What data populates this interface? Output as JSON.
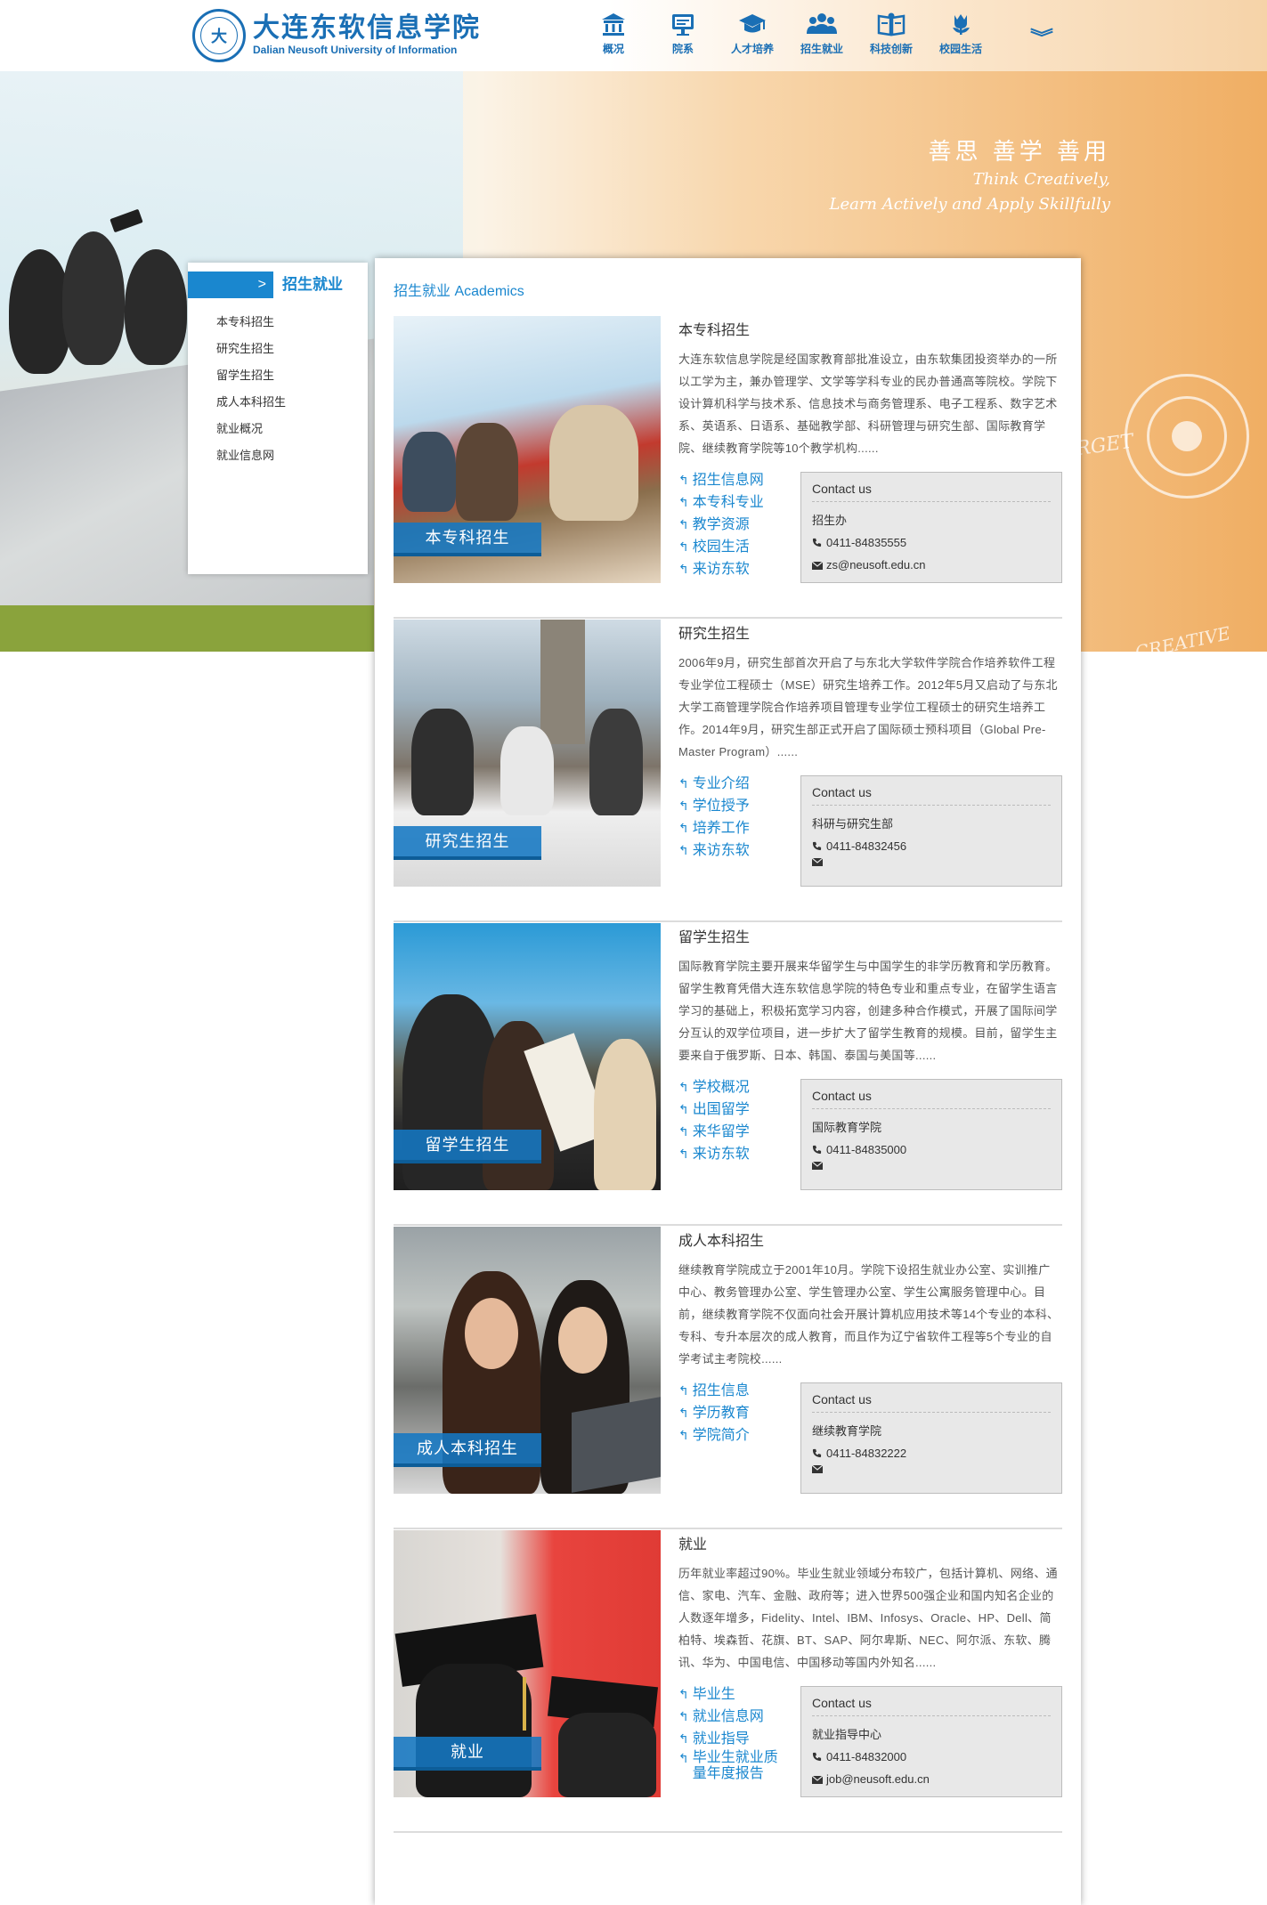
{
  "header": {
    "logo_seal": "大",
    "logo_cn": "大连东软信息学院",
    "logo_en": "Dalian Neusoft University of Information",
    "nav": [
      {
        "label": "概况",
        "icon": "building-icon"
      },
      {
        "label": "院系",
        "icon": "board-icon"
      },
      {
        "label": "人才培养",
        "icon": "graduation-cap-icon"
      },
      {
        "label": "招生就业",
        "icon": "people-icon"
      },
      {
        "label": "科技创新",
        "icon": "book-icon"
      },
      {
        "label": "校园生活",
        "icon": "tulip-icon"
      }
    ],
    "more_icon": "double-chevron-down-icon",
    "more_label": "︾"
  },
  "banner": {
    "slogan_cn": "善思 善学 善用",
    "slogan_en_1": "Think Creatively,",
    "slogan_en_2": "Learn Actively and Apply Skillfully",
    "sketch_word_1": "TARGET",
    "sketch_word_2": "CREATIVE"
  },
  "sidebar": {
    "arrow": ">",
    "title": "招生就业",
    "items": [
      "本专科招生",
      "研究生招生",
      "留学生招生",
      "成人本科招生",
      "就业概况",
      "就业信息网"
    ]
  },
  "main": {
    "title": "招生就业 Academics",
    "contact_title": "Contact us",
    "entries": [
      {
        "photo_label": "本专科招生",
        "title": "本专科招生",
        "desc": "大连东软信息学院是经国家教育部批准设立，由东软集团投资举办的一所以工学为主，兼办管理学、文学等学科专业的民办普通高等院校。学院下设计算机科学与技术系、信息技术与商务管理系、电子工程系、数字艺术系、英语系、日语系、基础教学部、科研管理与研究生部、国际教育学院、继续教育学院等10个教学机构......",
        "links": [
          "招生信息网",
          "本专科专业",
          "教学资源",
          "校园生活",
          "来访东软"
        ],
        "contact": {
          "dept": "招生办",
          "phone": "0411-84835555",
          "email": "zs@neusoft.edu.cn"
        }
      },
      {
        "photo_label": "研究生招生",
        "title": "研究生招生",
        "desc": "2006年9月，研究生部首次开启了与东北大学软件学院合作培养软件工程专业学位工程硕士（MSE）研究生培养工作。2012年5月又启动了与东北大学工商管理学院合作培养项目管理专业学位工程硕士的研究生培养工作。2014年9月，研究生部正式开启了国际硕士预科项目（Global Pre-Master Program）......",
        "links": [
          "专业介绍",
          "学位授予",
          "培养工作",
          "来访东软"
        ],
        "contact": {
          "dept": "科研与研究生部",
          "phone": "0411-84832456",
          "email": ""
        }
      },
      {
        "photo_label": "留学生招生",
        "title": "留学生招生",
        "desc": "国际教育学院主要开展来华留学生与中国学生的非学历教育和学历教育。留学生教育凭借大连东软信息学院的特色专业和重点专业，在留学生语言学习的基础上，积极拓宽学习内容，创建多种合作模式，开展了国际间学分互认的双学位项目，进一步扩大了留学生教育的规模。目前，留学生主要来自于俄罗斯、日本、韩国、泰国与美国等......",
        "links": [
          "学校概况",
          "出国留学",
          "来华留学",
          "来访东软"
        ],
        "contact": {
          "dept": "国际教育学院",
          "phone": "0411-84835000",
          "email": ""
        }
      },
      {
        "photo_label": "成人本科招生",
        "title": "成人本科招生",
        "desc": "继续教育学院成立于2001年10月。学院下设招生就业办公室、实训推广中心、教务管理办公室、学生管理办公室、学生公寓服务管理中心。目前，继续教育学院不仅面向社会开展计算机应用技术等14个专业的本科、专科、专升本层次的成人教育，而且作为辽宁省软件工程等5个专业的自学考试主考院校......",
        "links": [
          "招生信息",
          "学历教育",
          "学院简介"
        ],
        "contact": {
          "dept": "继续教育学院",
          "phone": "0411-84832222",
          "email": ""
        }
      },
      {
        "photo_label": "就业",
        "title": "就业",
        "desc": "历年就业率超过90%。毕业生就业领域分布较广，包括计算机、网络、通信、家电、汽车、金融、政府等；进入世界500强企业和国内知名企业的人数逐年增多，Fidelity、Intel、IBM、Infosys、Oracle、HP、Dell、简柏特、埃森哲、花旗、BT、SAP、阿尔卑斯、NEC、阿尔派、东软、腾讯、华为、中国电信、中国移动等国内外知名......",
        "links": [
          "毕业生",
          "就业信息网",
          "就业指导",
          "毕业生就业质量年度报告"
        ],
        "contact": {
          "dept": "就业指导中心",
          "phone": "0411-84832000",
          "email": "job@neusoft.edu.cn"
        }
      }
    ]
  },
  "colors": {
    "accent": "#1a87cf",
    "brand": "#1a6fb5",
    "banner_orange": "#f0ae63"
  }
}
